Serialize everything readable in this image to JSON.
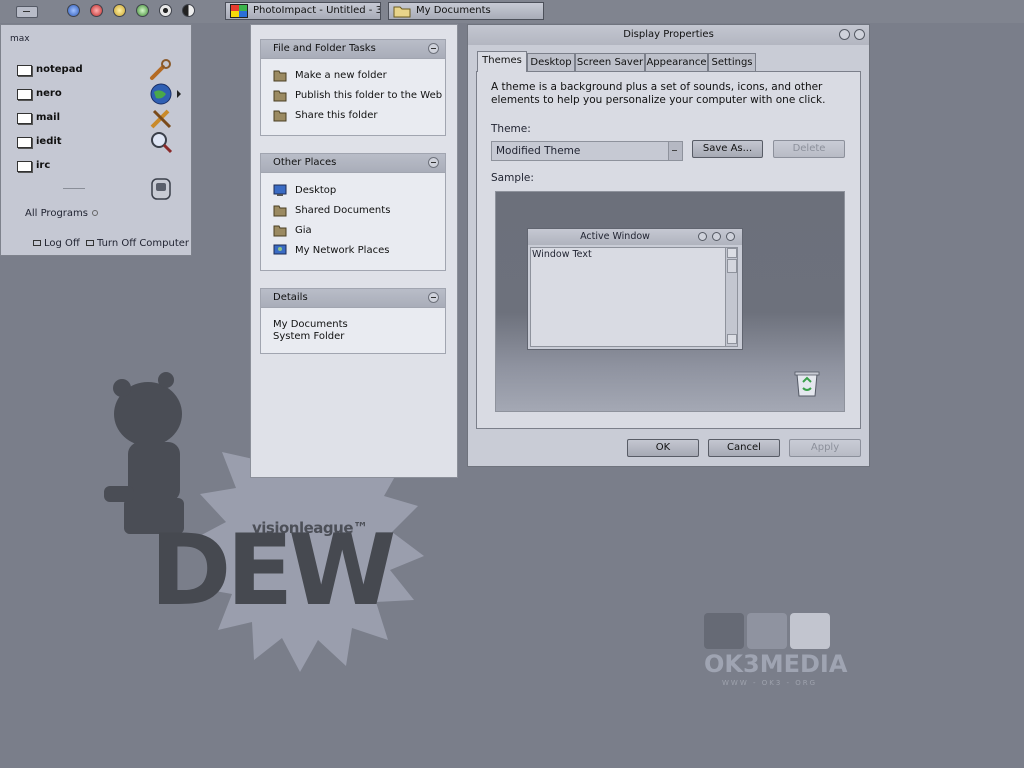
{
  "taskbar": {
    "tray_icons": [
      "blue-circle-icon",
      "red-circle-icon",
      "yellow-circle-icon",
      "green-circle-icon",
      "radio-circle-icon",
      "yin-yang-icon"
    ],
    "tasks": [
      {
        "label": "PhotoImpact - Untitled - 3",
        "icon": "photoimpact-icon"
      },
      {
        "label": "My Documents",
        "icon": "folder-icon"
      }
    ]
  },
  "start_menu": {
    "user": "max",
    "items": [
      {
        "label": "notepad",
        "icon": "wrench-icon"
      },
      {
        "label": "nero",
        "icon": "globe-icon"
      },
      {
        "label": "mail",
        "icon": "tools-icon"
      },
      {
        "label": "iedit",
        "icon": "magnifier-icon"
      },
      {
        "label": "irc",
        "icon": "chat-icon"
      }
    ],
    "all_programs": "All Programs",
    "log_off": "Log Off",
    "turn_off": "Turn Off Computer"
  },
  "explorer": {
    "file_tasks": {
      "title": "File and Folder Tasks",
      "links": [
        "Make a new folder",
        "Publish this folder to the Web",
        "Share this folder"
      ]
    },
    "other_places": {
      "title": "Other Places",
      "links": [
        "Desktop",
        "Shared Documents",
        "Gia",
        "My Network Places"
      ]
    },
    "details": {
      "title": "Details",
      "name": "My Documents",
      "type": "System Folder"
    }
  },
  "dialog": {
    "title": "Display Properties",
    "tabs": [
      "Themes",
      "Desktop",
      "Screen Saver",
      "Appearance",
      "Settings"
    ],
    "active_tab": "Themes",
    "description": "A theme is a background plus a set of sounds, icons, and other elements to help you personalize your computer with one click.",
    "theme_label": "Theme:",
    "theme_value": "Modified Theme",
    "save_as": "Save As...",
    "delete": "Delete",
    "sample_label": "Sample:",
    "sample_window_title": "Active Window",
    "sample_window_text": "Window Text",
    "ok": "OK",
    "cancel": "Cancel",
    "apply": "Apply"
  },
  "wallpaper": {
    "brand": "visionleague™",
    "logo": "DEW",
    "watermark": "OK3MEDIA",
    "watermark_sub": "WWW - OK3 - ORG"
  },
  "colors": {
    "desktop": "#7a7e8a",
    "panel": "#dfe1e8",
    "dialog": "#c9ccd6",
    "header": "#a9adb9"
  }
}
